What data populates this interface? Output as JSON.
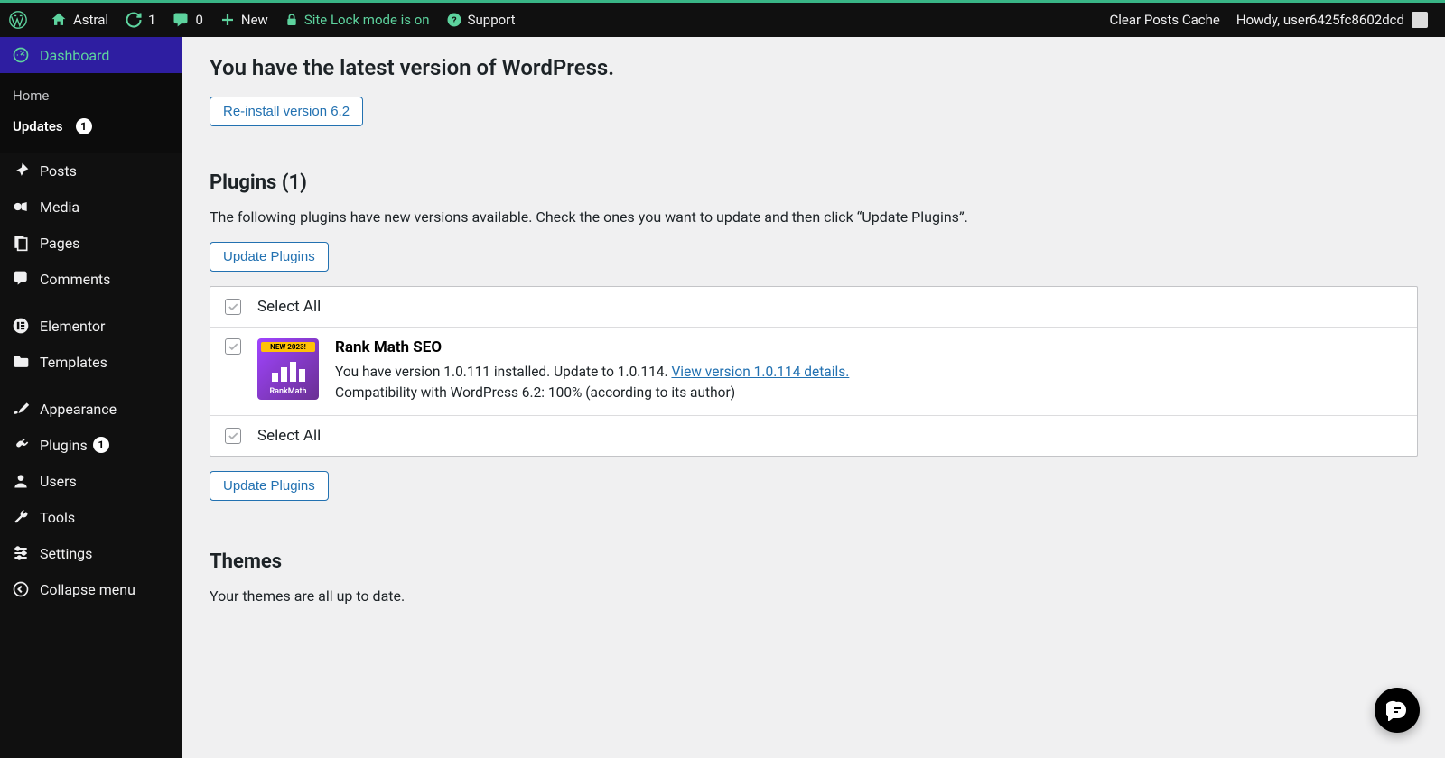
{
  "adminbar": {
    "site_name": "Astral",
    "updates_count": "1",
    "comments_count": "0",
    "new_label": "New",
    "lock_label": "Site Lock mode is on",
    "support_label": "Support",
    "clear_cache": "Clear Posts Cache",
    "howdy": "Howdy, user6425fc8602dcd"
  },
  "sidebar": {
    "dashboard": "Dashboard",
    "home": "Home",
    "updates": "Updates",
    "updates_count": "1",
    "posts": "Posts",
    "media": "Media",
    "pages": "Pages",
    "comments": "Comments",
    "elementor": "Elementor",
    "templates": "Templates",
    "appearance": "Appearance",
    "plugins": "Plugins",
    "plugins_count": "1",
    "users": "Users",
    "tools": "Tools",
    "settings": "Settings",
    "collapse": "Collapse menu"
  },
  "main": {
    "heading": "You have the latest version of WordPress.",
    "reinstall_btn": "Re-install version 6.2",
    "plugins_heading": "Plugins (1)",
    "plugins_desc": "The following plugins have new versions available. Check the ones you want to update and then click “Update Plugins”.",
    "update_plugins_btn": "Update Plugins",
    "select_all": "Select All",
    "plugin": {
      "icon_tag": "NEW 2023!",
      "icon_brand": "RankMath",
      "name": "Rank Math SEO",
      "line1_a": "You have version 1.0.111 installed. Update to 1.0.114. ",
      "link": "View version 1.0.114 details.",
      "line2": "Compatibility with WordPress 6.2: 100% (according to its author)"
    },
    "themes_heading": "Themes",
    "themes_desc": "Your themes are all up to date."
  }
}
